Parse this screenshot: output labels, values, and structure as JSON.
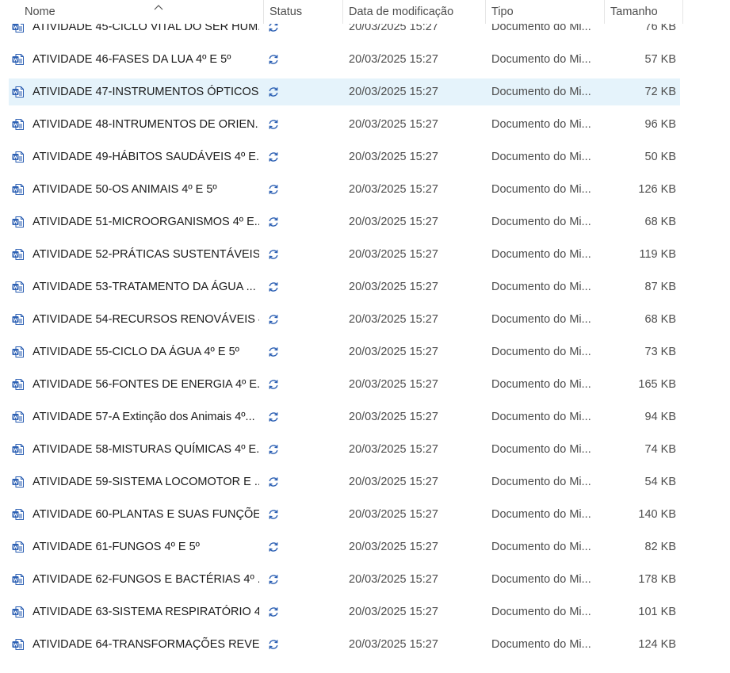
{
  "columns": {
    "name": "Nome",
    "status": "Status",
    "date": "Data de modificação",
    "type": "Tipo",
    "size": "Tamanho"
  },
  "icons": {
    "file": "word-document-icon",
    "status": "sync-icon"
  },
  "accent": "#2b5fb3",
  "files": [
    {
      "name": "ATIVIDADE 45-CICLO VITAL DO SER HUM...",
      "date": "20/03/2025 15:27",
      "type": "Documento do Mi...",
      "size": "76 KB"
    },
    {
      "name": "ATIVIDADE 46-FASES DA LUA 4º E 5º",
      "date": "20/03/2025 15:27",
      "type": "Documento do Mi...",
      "size": "57 KB"
    },
    {
      "name": "ATIVIDADE 47-INSTRUMENTOS ÓPTICOS...",
      "date": "20/03/2025 15:27",
      "type": "Documento do Mi...",
      "size": "72 KB",
      "selected": true
    },
    {
      "name": "ATIVIDADE 48-INTRUMENTOS DE ORIEN...",
      "date": "20/03/2025 15:27",
      "type": "Documento do Mi...",
      "size": "96 KB"
    },
    {
      "name": "ATIVIDADE 49-HÁBITOS SAUDÁVEIS 4º E...",
      "date": "20/03/2025 15:27",
      "type": "Documento do Mi...",
      "size": "50 KB"
    },
    {
      "name": "ATIVIDADE 50-OS ANIMAIS 4º E 5º",
      "date": "20/03/2025 15:27",
      "type": "Documento do Mi...",
      "size": "126 KB"
    },
    {
      "name": "ATIVIDADE 51-MICROORGANISMOS 4º E...",
      "date": "20/03/2025 15:27",
      "type": "Documento do Mi...",
      "size": "68 KB"
    },
    {
      "name": "ATIVIDADE 52-PRÁTICAS SUSTENTÁVEIS ...",
      "date": "20/03/2025 15:27",
      "type": "Documento do Mi...",
      "size": "119 KB"
    },
    {
      "name": "ATIVIDADE 53-TRATAMENTO DA ÁGUA ...",
      "date": "20/03/2025 15:27",
      "type": "Documento do Mi...",
      "size": "87 KB"
    },
    {
      "name": "ATIVIDADE 54-RECURSOS RENOVÁVEIS 4...",
      "date": "20/03/2025 15:27",
      "type": "Documento do Mi...",
      "size": "68 KB"
    },
    {
      "name": "ATIVIDADE 55-CICLO DA ÁGUA 4º E 5º",
      "date": "20/03/2025 15:27",
      "type": "Documento do Mi...",
      "size": "73 KB"
    },
    {
      "name": "ATIVIDADE 56-FONTES DE ENERGIA 4º E...",
      "date": "20/03/2025 15:27",
      "type": "Documento do Mi...",
      "size": "165 KB"
    },
    {
      "name": "ATIVIDADE 57-A Extinção dos Animais 4º...",
      "date": "20/03/2025 15:27",
      "type": "Documento do Mi...",
      "size": "94 KB"
    },
    {
      "name": "ATIVIDADE 58-MISTURAS QUÍMICAS 4º E...",
      "date": "20/03/2025 15:27",
      "type": "Documento do Mi...",
      "size": "74 KB"
    },
    {
      "name": "ATIVIDADE 59-SISTEMA LOCOMOTOR E ...",
      "date": "20/03/2025 15:27",
      "type": "Documento do Mi...",
      "size": "54 KB"
    },
    {
      "name": "ATIVIDADE 60-PLANTAS E SUAS FUNÇÕE...",
      "date": "20/03/2025 15:27",
      "type": "Documento do Mi...",
      "size": "140 KB"
    },
    {
      "name": "ATIVIDADE 61-FUNGOS 4º E 5º",
      "date": "20/03/2025 15:27",
      "type": "Documento do Mi...",
      "size": "82 KB"
    },
    {
      "name": "ATIVIDADE 62-FUNGOS E BACTÉRIAS 4º ...",
      "date": "20/03/2025 15:27",
      "type": "Documento do Mi...",
      "size": "178 KB"
    },
    {
      "name": "ATIVIDADE 63-SISTEMA RESPIRATÓRIO 4...",
      "date": "20/03/2025 15:27",
      "type": "Documento do Mi...",
      "size": "101 KB"
    },
    {
      "name": "ATIVIDADE 64-TRANSFORMAÇÕES REVE...",
      "date": "20/03/2025 15:27",
      "type": "Documento do Mi...",
      "size": "124 KB"
    }
  ]
}
